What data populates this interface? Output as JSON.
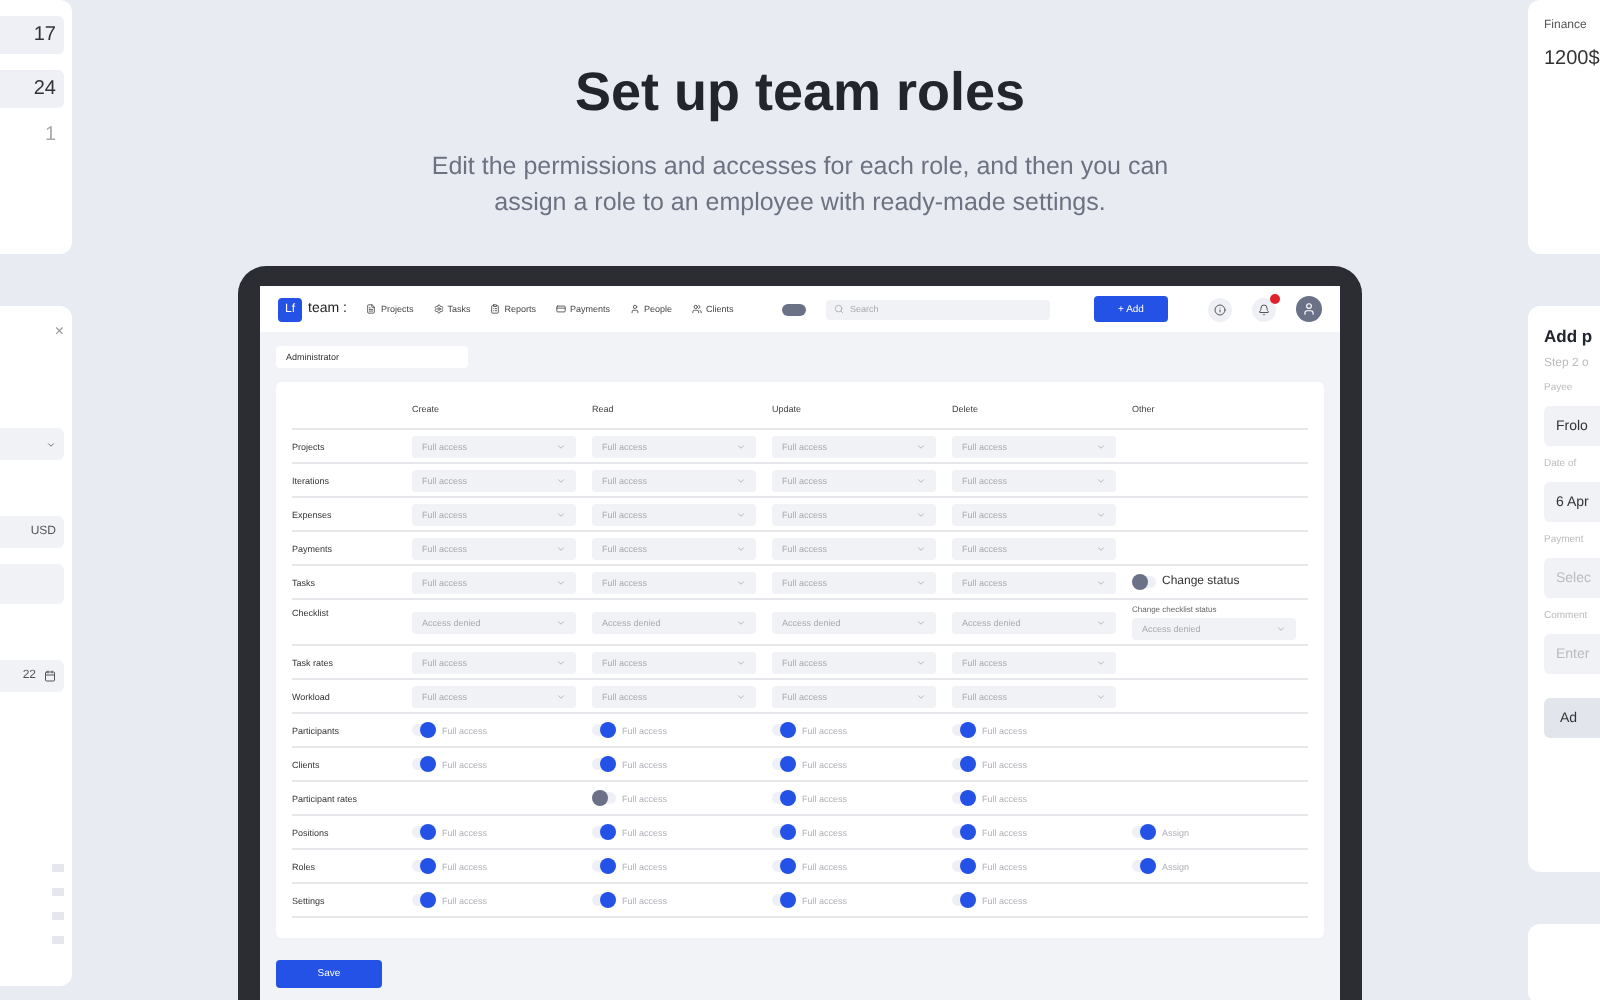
{
  "left_cards": {
    "calendar_numbers": [
      "17",
      "24",
      "1"
    ],
    "currency": "USD",
    "date_fragment": "22",
    "close": "×"
  },
  "heading": "Set up team roles",
  "subtitle": "Edit the permissions and accesses for each role, and then you can assign a role to an employee with ready-made settings.",
  "app": {
    "logo": "Lf",
    "brand": "team :",
    "nav": [
      "Projects",
      "Tasks",
      "Reports",
      "Payments",
      "People",
      "Clients"
    ],
    "search": {
      "placeholder": "Search"
    },
    "add_button": "+ Add",
    "role_field": "Administrator",
    "columns": [
      "Create",
      "Read",
      "Update",
      "Delete",
      "Other"
    ],
    "rows": [
      {
        "label": "Projects",
        "cells": [
          {
            "kind": "select",
            "value": "Full access"
          },
          {
            "kind": "select",
            "value": "Full access"
          },
          {
            "kind": "select",
            "value": "Full access"
          },
          {
            "kind": "select",
            "value": "Full access"
          },
          null
        ]
      },
      {
        "label": "Iterations",
        "cells": [
          {
            "kind": "select",
            "value": "Full access"
          },
          {
            "kind": "select",
            "value": "Full access"
          },
          {
            "kind": "select",
            "value": "Full access"
          },
          {
            "kind": "select",
            "value": "Full access"
          },
          null
        ]
      },
      {
        "label": "Expenses",
        "cells": [
          {
            "kind": "select",
            "value": "Full access"
          },
          {
            "kind": "select",
            "value": "Full access"
          },
          {
            "kind": "select",
            "value": "Full access"
          },
          {
            "kind": "select",
            "value": "Full access"
          },
          null
        ]
      },
      {
        "label": "Payments",
        "cells": [
          {
            "kind": "select",
            "value": "Full access"
          },
          {
            "kind": "select",
            "value": "Full access"
          },
          {
            "kind": "select",
            "value": "Full access"
          },
          {
            "kind": "select",
            "value": "Full access"
          },
          null
        ]
      },
      {
        "label": "Tasks",
        "cells": [
          {
            "kind": "select",
            "value": "Full access"
          },
          {
            "kind": "select",
            "value": "Full access"
          },
          {
            "kind": "select",
            "value": "Full access"
          },
          {
            "kind": "select",
            "value": "Full access"
          },
          {
            "kind": "switch",
            "on": false,
            "label": "Change status"
          }
        ]
      },
      {
        "label": "Checklist",
        "cells": [
          {
            "kind": "select",
            "value": "Access denied"
          },
          {
            "kind": "select",
            "value": "Access denied"
          },
          {
            "kind": "select",
            "value": "Access denied"
          },
          {
            "kind": "select",
            "value": "Access denied"
          },
          {
            "kind": "select",
            "caption": "Change checklist status",
            "value": "Access denied"
          }
        ]
      },
      {
        "label": "Task rates",
        "cells": [
          {
            "kind": "select",
            "value": "Full access"
          },
          {
            "kind": "select",
            "value": "Full access"
          },
          {
            "kind": "select",
            "value": "Full access"
          },
          {
            "kind": "select",
            "value": "Full access"
          },
          null
        ]
      },
      {
        "label": "Workload",
        "cells": [
          {
            "kind": "select",
            "value": "Full access"
          },
          {
            "kind": "select",
            "value": "Full access"
          },
          {
            "kind": "select",
            "value": "Full access"
          },
          {
            "kind": "select",
            "value": "Full access"
          },
          null
        ]
      },
      {
        "label": "Participants",
        "cells": [
          {
            "kind": "toggle",
            "on": true,
            "label": "Full access"
          },
          {
            "kind": "toggle",
            "on": true,
            "label": "Full access"
          },
          {
            "kind": "toggle",
            "on": true,
            "label": "Full access"
          },
          {
            "kind": "toggle",
            "on": true,
            "label": "Full access"
          },
          null
        ]
      },
      {
        "label": "Clients",
        "cells": [
          {
            "kind": "toggle",
            "on": true,
            "label": "Full access"
          },
          {
            "kind": "toggle",
            "on": true,
            "label": "Full access"
          },
          {
            "kind": "toggle",
            "on": true,
            "label": "Full access"
          },
          {
            "kind": "toggle",
            "on": true,
            "label": "Full access"
          },
          null
        ]
      },
      {
        "label": "Participant rates",
        "cells": [
          null,
          {
            "kind": "toggle",
            "on": false,
            "label": "Full access"
          },
          {
            "kind": "toggle",
            "on": true,
            "label": "Full access"
          },
          {
            "kind": "toggle",
            "on": true,
            "label": "Full access"
          },
          null
        ]
      },
      {
        "label": "Positions",
        "cells": [
          {
            "kind": "toggle",
            "on": true,
            "label": "Full access"
          },
          {
            "kind": "toggle",
            "on": true,
            "label": "Full access"
          },
          {
            "kind": "toggle",
            "on": true,
            "label": "Full access"
          },
          {
            "kind": "toggle",
            "on": true,
            "label": "Full access"
          },
          {
            "kind": "toggle",
            "on": true,
            "label": "Assign"
          }
        ]
      },
      {
        "label": "Roles",
        "cells": [
          {
            "kind": "toggle",
            "on": true,
            "label": "Full access"
          },
          {
            "kind": "toggle",
            "on": true,
            "label": "Full access"
          },
          {
            "kind": "toggle",
            "on": true,
            "label": "Full access"
          },
          {
            "kind": "toggle",
            "on": true,
            "label": "Full access"
          },
          {
            "kind": "toggle",
            "on": true,
            "label": "Assign"
          }
        ]
      },
      {
        "label": "Settings",
        "cells": [
          {
            "kind": "toggle",
            "on": true,
            "label": "Full access"
          },
          {
            "kind": "toggle",
            "on": true,
            "label": "Full access"
          },
          {
            "kind": "toggle",
            "on": true,
            "label": "Full access"
          },
          {
            "kind": "toggle",
            "on": true,
            "label": "Full access"
          },
          null
        ]
      }
    ],
    "save_button": "Save"
  },
  "right_cards": {
    "finance_label": "Finance",
    "amount": "1200$",
    "form_title": "Add p",
    "step": "Step 2 o",
    "fields": [
      {
        "label": "Payee",
        "value": "Frolo"
      },
      {
        "label": "Date of",
        "value": "6 Apr"
      },
      {
        "label": "Payment",
        "placeholder": "Selec"
      },
      {
        "label": "Comment",
        "placeholder": "Enter"
      }
    ],
    "submit": "Ad"
  }
}
